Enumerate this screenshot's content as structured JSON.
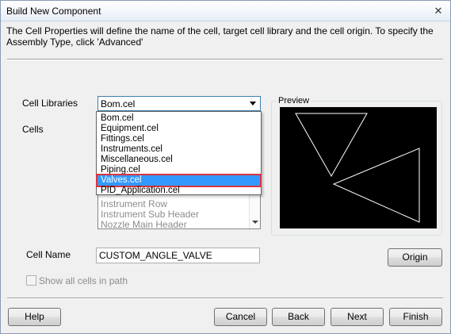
{
  "window": {
    "title": "Build New Component",
    "close_glyph": "✕"
  },
  "description": "The Cell Properties will define the name of the cell, target cell library and the cell origin.  To specify the Assembly Type, click 'Advanced'",
  "cell_libraries": {
    "label": "Cell Libraries",
    "selected_value": "Bom.cel",
    "options": [
      "Bom.cel",
      "Equipment.cel",
      "Fittings.cel",
      "Instruments.cel",
      "Miscellaneous.cel",
      "Piping.cel",
      "Valves.cel",
      "PID_Application.cel"
    ],
    "highlighted_option": "Valves.cel"
  },
  "cells": {
    "label": "Cells",
    "visible_items": [
      "Instrument Row",
      "Instrument Sub Header",
      "Nozzle Main Header"
    ]
  },
  "preview": {
    "label": "Preview",
    "background": "#000000",
    "line_color": "#ffffff"
  },
  "cell_name": {
    "label": "Cell Name",
    "value": "CUSTOM_ANGLE_VALVE"
  },
  "origin_button": "Origin",
  "show_all_cells": {
    "label": "Show all cells in path",
    "checked": false,
    "enabled": false
  },
  "footer": {
    "help": "Help",
    "cancel": "Cancel",
    "back": "Back",
    "next": "Next",
    "finish": "Finish"
  },
  "colors": {
    "selection": "#3399ff",
    "highlight_outline": "#d9363e"
  }
}
